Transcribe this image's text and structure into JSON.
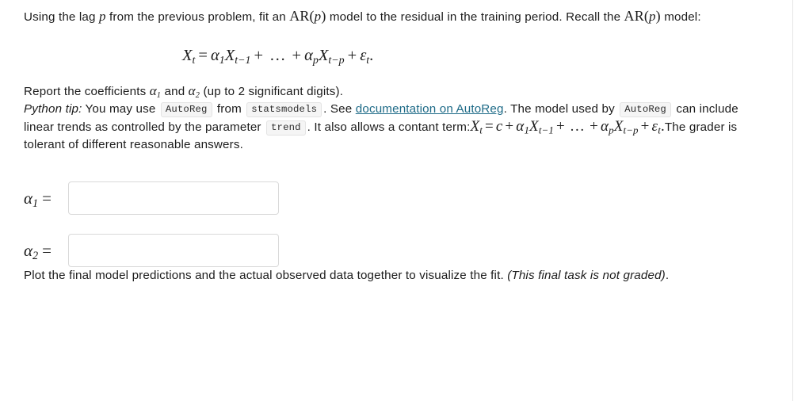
{
  "problem": {
    "intro": {
      "part1": "Using the lag ",
      "lag_symbol": "p",
      "part2": " from the previous problem, fit an ",
      "model_ar": "AR",
      "model_arg_open": "(",
      "model_arg": "p",
      "model_arg_close": ")",
      "part3": " model to the residual in the training period. Recall the ",
      "model_ar2": "AR",
      "model2_arg_open": "(",
      "model2_arg": "p",
      "model2_arg_close": ")",
      "part4": " model:"
    },
    "display_equation": {
      "lhs_var": "X",
      "lhs_sub": "t",
      "eq": "=",
      "a1": "α",
      "a1_sub": "1",
      "x1": "X",
      "x1_sub": "t−1",
      "plus1": "+",
      "ellipsis": "…",
      "plus2": "+",
      "ap": "α",
      "ap_sub": "p",
      "xp": "X",
      "xp_sub": "t−p",
      "plus3": "+",
      "eps": "ε",
      "eps_sub": "t",
      "period": "."
    },
    "report_line": {
      "part1": "Report the coefficients ",
      "alpha": "α",
      "alpha1_sub": "1",
      "part2": " and ",
      "alpha2": "α",
      "alpha2_sub": "2",
      "part3": " (up to 2 significant digits)."
    },
    "tip": {
      "label": "Python tip:",
      "t1": " You may use ",
      "code_autoreg": "AutoReg",
      "t2": " from ",
      "code_statsmodels": "statsmodels",
      "t3": ". See ",
      "link_text": "documentation on AutoReg",
      "t4": ". The model used by ",
      "code_autoreg2": "AutoReg",
      "t5": " can include linear trends as controlled by the parameter ",
      "code_trend": "trend",
      "t6": ". It also allows a contant term:",
      "t7": "The grader is tolerant of different reasonable answers."
    },
    "tip_equation": {
      "lhs_var": "X",
      "lhs_sub": "t",
      "eq": "=",
      "c": "c",
      "plus0": "+",
      "a1": "α",
      "a1_sub": "1",
      "x1": "X",
      "x1_sub": "t−1",
      "plus1": "+",
      "ellipsis": "…",
      "plus2": "+",
      "ap": "α",
      "ap_sub": "p",
      "xp": "X",
      "xp_sub": "t−p",
      "plus3": "+",
      "eps": "ε",
      "eps_sub": "t",
      "period": "."
    },
    "answers": [
      {
        "symbol": "α",
        "subscript": "1",
        "equals": "=",
        "value": "",
        "placeholder": ""
      },
      {
        "symbol": "α",
        "subscript": "2",
        "equals": "=",
        "value": "",
        "placeholder": ""
      }
    ],
    "final_note": {
      "part1": "Plot the final model predictions and the actual observed data together to visualize the fit. ",
      "italic_part": "(This final task is not graded)",
      "part2": "."
    }
  },
  "colors": {
    "text": "#1c1c1c",
    "link": "#1d6a87",
    "code_bg": "#f5f5f5",
    "code_border": "#e3e3e3",
    "input_border": "#d9d9d9",
    "page_edge": "#e6e6e6"
  }
}
